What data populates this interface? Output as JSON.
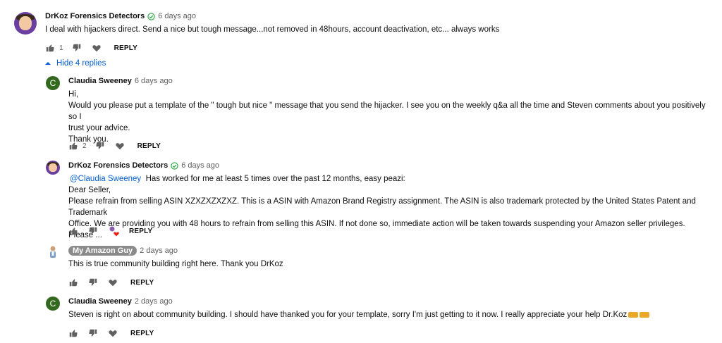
{
  "thread": {
    "top": {
      "author": "DrKoz Forensics Detectors",
      "age": "6 days ago",
      "text": "I deal with hijackers direct. Send a nice but tough message...not removed in 48hours, account deactivation, etc... always works",
      "likes": "1",
      "reply_label": "REPLY"
    },
    "hide_replies_label": "Hide 4 replies",
    "replies": [
      {
        "author": "Claudia Sweeney",
        "avatar_letter": "C",
        "age": "6 days ago",
        "lines": [
          "Hi,",
          "Would you please put a template of the \" tough but nice \" message that you send the hijacker. I see you on the weekly q&a all the time and Steven comments about you positively so I",
          "trust your advice.",
          "Thank you."
        ],
        "likes": "2",
        "reply_label": "REPLY"
      },
      {
        "author": "DrKoz Forensics Detectors",
        "age": "6 days ago",
        "mention": "@Claudia Sweeney",
        "first_line": "Has worked for me at least 5 times over the past 12 months, easy peazi:",
        "lines": [
          "Dear Seller,",
          "Please refrain from selling ASIN XZXZXZXZXZ. This is a ASIN with Amazon Brand Registry assignment. The ASIN is also trademark protected by the United States Patent and Trademark",
          "Office. We are providing you with 48 hours to refrain from selling this ASIN. If not done so, immediate action will be taken towards suspending your Amazon seller privileges. Please ..."
        ],
        "reply_label": "REPLY"
      },
      {
        "author": "My Amazon Guy",
        "age": "2 days ago",
        "text": "This is true community building right here. Thank you DrKoz",
        "reply_label": "REPLY"
      },
      {
        "author": "Claudia Sweeney",
        "avatar_letter": "C",
        "age": "2 days ago",
        "text": "Steven is right on about community building. I should have thanked you for your template, sorry I'm just getting to it now. I really appreciate your help Dr.Koz",
        "reply_label": "REPLY"
      }
    ]
  },
  "colors": {
    "link": "#065fd4",
    "verified": "#2ba640",
    "claudia_avatar": "#33691e",
    "heart": "#e62117"
  },
  "icons": [
    "thumb-up-icon",
    "thumb-down-icon",
    "heart-icon",
    "verified-check-icon",
    "caret-up-icon",
    "creator-heart-icon"
  ]
}
